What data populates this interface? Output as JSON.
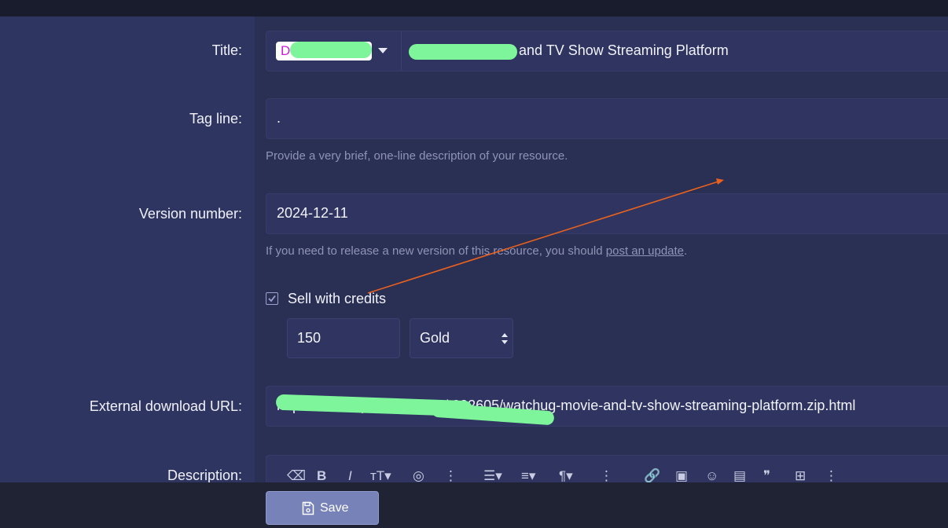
{
  "form": {
    "title": {
      "label": "Title:",
      "prefix": "DOWNLOAD",
      "value": "and TV Show Streaming Platform"
    },
    "tagline": {
      "label": "Tag line:",
      "value": ".",
      "hint": "Provide a very brief, one-line description of your resource."
    },
    "version": {
      "label": "Version number:",
      "value": "2024-12-11",
      "hint_prefix": "If you need to release a new version of this resource, you should ",
      "hint_link": "post an update",
      "hint_suffix": "."
    },
    "credits": {
      "checkbox_label": "Sell with credits",
      "checked": true,
      "amount": "150",
      "currency": "Gold"
    },
    "external_url": {
      "label": "External download URL:",
      "value": "https://www.uploadee/ files/ 002605/watchug-movie-and-tv-show-streaming-platform.zip.html"
    },
    "description": {
      "label": "Description:"
    }
  },
  "footer": {
    "save_label": "Save"
  },
  "colors": {
    "label_column": "#2f3561",
    "content_background": "#2a2f54",
    "footer": "#1f2334",
    "save_button": "#7783b8",
    "annotation_arrow": "#e8611e",
    "redaction_highlight": "#7ef59a",
    "prefix_text": "#d21ad6"
  },
  "icons": {
    "toolbar": [
      "eraser-icon",
      "bold-icon",
      "italic-icon",
      "text-size-icon",
      "palette-icon",
      "more-icon",
      "list-icon",
      "align-icon",
      "paragraph-icon",
      "more-icon",
      "link-icon",
      "image-icon",
      "emoji-icon",
      "media-icon",
      "quote-icon",
      "table-icon",
      "more-icon"
    ]
  }
}
